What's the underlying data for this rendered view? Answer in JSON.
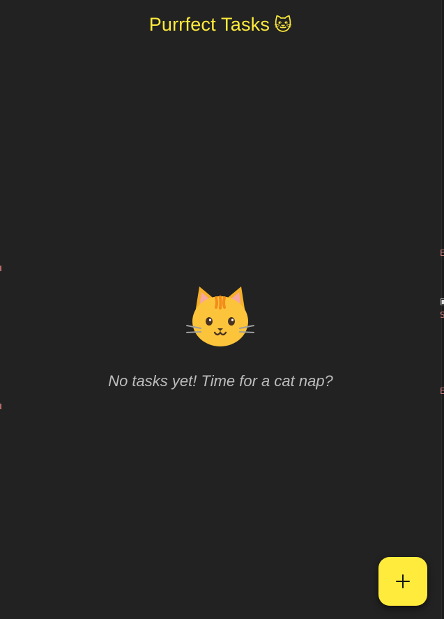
{
  "header": {
    "title": "Purrfect Tasks",
    "title_emoji": "🐱"
  },
  "empty_state": {
    "icon": "cat-face-icon",
    "message": "No tasks yet! Time for a cat nap?"
  },
  "fab": {
    "icon": "plus-icon"
  },
  "colors": {
    "background": "#222222",
    "accent": "#ffeb3b",
    "muted_text": "#bdbdbd"
  }
}
